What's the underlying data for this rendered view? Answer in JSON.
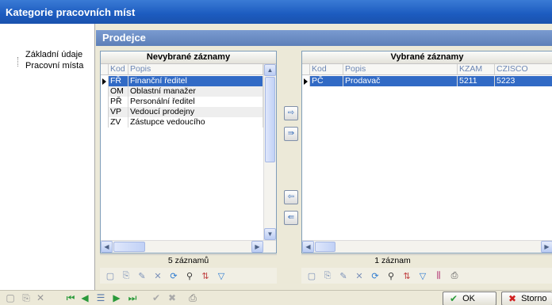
{
  "window": {
    "title": "Kategorie pracovních míst"
  },
  "sidebar": {
    "items": [
      "Základní údaje",
      "Pracovní místa"
    ]
  },
  "header": {
    "title": "Prodejce"
  },
  "left_panel": {
    "title": "Nevybrané záznamy",
    "columns": [
      "Kod",
      "Popis"
    ],
    "rows": [
      [
        "FŘ",
        "Finanční ředitel"
      ],
      [
        "OM",
        "Oblastní manažer"
      ],
      [
        "PŘ",
        "Personální ředitel"
      ],
      [
        "VP",
        "Vedoucí prodejny"
      ],
      [
        "ZV",
        "Zástupce vedoucího"
      ]
    ],
    "status": "5 záznamů"
  },
  "right_panel": {
    "title": "Vybrané záznamy",
    "columns": [
      "Kod",
      "Popis",
      "KZAM",
      "CZISCO"
    ],
    "rows": [
      [
        "PČ",
        "Prodavač",
        "5211",
        "5223"
      ]
    ],
    "status": "1 záznam"
  },
  "footer": {
    "ok_label": "OK",
    "cancel_label": "Storno"
  },
  "colors": {
    "selection": "#316ac5",
    "titlebar": "#1c5bbf",
    "header": "#6a8bc3"
  }
}
